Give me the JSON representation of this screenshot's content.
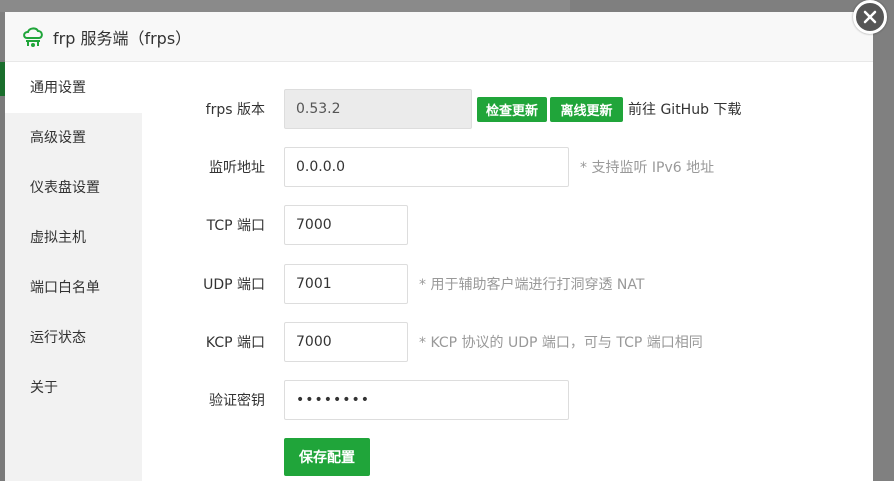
{
  "modal": {
    "title": "frp 服务端（frps）",
    "close_label": "×"
  },
  "sidebar": {
    "items": [
      {
        "label": "通用设置",
        "active": true
      },
      {
        "label": "高级设置"
      },
      {
        "label": "仪表盘设置"
      },
      {
        "label": "虚拟主机"
      },
      {
        "label": "端口白名单"
      },
      {
        "label": "运行状态"
      },
      {
        "label": "关于"
      }
    ]
  },
  "form": {
    "version": {
      "label": "frps 版本",
      "value": "0.53.2",
      "check_update": "检查更新",
      "offline_update": "离线更新",
      "github_link": "前往 GitHub 下载"
    },
    "listen_addr": {
      "label": "监听地址",
      "value": "0.0.0.0",
      "hint": "* 支持监听 IPv6 地址"
    },
    "tcp_port": {
      "label": "TCP 端口",
      "value": "7000"
    },
    "udp_port": {
      "label": "UDP 端口",
      "value": "7001",
      "hint": "* 用于辅助客户端进行打洞穿透 NAT"
    },
    "kcp_port": {
      "label": "KCP 端口",
      "value": "7000",
      "hint": "* KCP 协议的 UDP 端口，可与 TCP 端口相同"
    },
    "auth_token": {
      "label": "验证密钥",
      "value": "••••••••"
    },
    "save_label": "保存配置"
  },
  "colors": {
    "accent": "#20a53a",
    "sidebar_bg": "#f2f2f2",
    "header_bg": "#f8f8f8"
  },
  "icons": {
    "logo": "frp-cloud-icon",
    "close": "close-icon"
  }
}
